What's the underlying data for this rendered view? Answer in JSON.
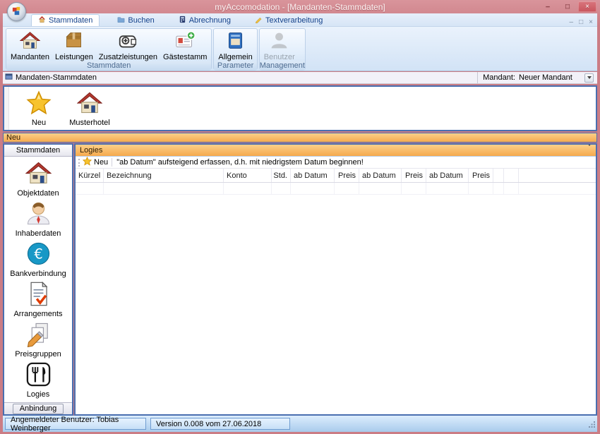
{
  "window": {
    "title": "myAccomodation - [Mandanten-Stammdaten]",
    "controls": {
      "minimize": "–",
      "maximize": "□",
      "close": "×"
    }
  },
  "mdi_controls": {
    "minimize": "–",
    "restore": "□",
    "close": "×"
  },
  "ribbon": {
    "tabs": [
      {
        "label": "Stammdaten",
        "icon": "stammdaten-tab-icon",
        "active": true
      },
      {
        "label": "Buchen",
        "icon": "buchen-tab-icon",
        "active": false
      },
      {
        "label": "Abrechnung",
        "icon": "abrechnung-tab-icon",
        "active": false
      },
      {
        "label": "Textverarbeitung",
        "icon": "textverarbeitung-tab-icon",
        "active": false
      }
    ],
    "groups": [
      {
        "label": "Stammdaten",
        "buttons": [
          {
            "label": "Mandanten",
            "icon": "house-icon"
          },
          {
            "label": "Leistungen",
            "icon": "package-icon"
          },
          {
            "label": "Zusatzleistungen",
            "icon": "wallet-add-icon"
          },
          {
            "label": "Gästestamm",
            "icon": "contact-add-icon"
          }
        ]
      },
      {
        "label": "Parameter",
        "buttons": [
          {
            "label": "Allgemein",
            "icon": "drawer-icon"
          }
        ]
      },
      {
        "label": "Management",
        "buttons": [
          {
            "label": "Benutzer",
            "icon": "user-icon",
            "disabled": true
          }
        ]
      }
    ]
  },
  "caption_bar": {
    "icon": "window-icon",
    "title": "Mandaten-Stammdaten",
    "mandant_label": "Mandant:",
    "mandant_value": "Neuer Mandant"
  },
  "toolbar": {
    "buttons": [
      {
        "label": "Neu",
        "icon": "star-icon"
      },
      {
        "label": "Musterhotel",
        "icon": "hotel-icon"
      }
    ]
  },
  "section_bar": {
    "label": "Neu"
  },
  "sidebar": {
    "header": "Stammdaten",
    "items": [
      {
        "label": "Objektdaten",
        "icon": "house-icon"
      },
      {
        "label": "Inhaberdaten",
        "icon": "person-icon"
      },
      {
        "label": "Bankverbindung",
        "icon": "euro-icon"
      },
      {
        "label": "Arrangements",
        "icon": "document-check-icon"
      },
      {
        "label": "Preisgruppen",
        "icon": "pages-pencil-icon"
      },
      {
        "label": "Logies",
        "icon": "cutlery-icon"
      }
    ],
    "footer": "Anbindung"
  },
  "panel": {
    "header": "Logies",
    "toolbar": {
      "new_label": "Neu",
      "new_icon": "star-icon",
      "hint": "\"ab Datum\" aufsteigend erfassen, d.h. mit niedrigstem Datum beginnen!"
    },
    "table": {
      "columns": [
        "Kürzel",
        "Bezeichnung",
        "Konto",
        "Std.",
        "ab Datum",
        "Preis",
        "ab Datum",
        "Preis",
        "ab Datum",
        "Preis"
      ]
    }
  },
  "status_bar": {
    "user": "Angemeldeter Benutzer: Tobias Weinberger",
    "version": "Version 0.008 vom 27.06.2018"
  },
  "colors": {
    "titlebar": "#cb7d85",
    "close_button": "#c8545c",
    "ribbon_bg": "#d9e8f8",
    "tab_text": "#15428b",
    "accent_orange": "#f6aa50",
    "panel_border": "#4a6fb0",
    "status_bg": "#b9d5f0"
  }
}
